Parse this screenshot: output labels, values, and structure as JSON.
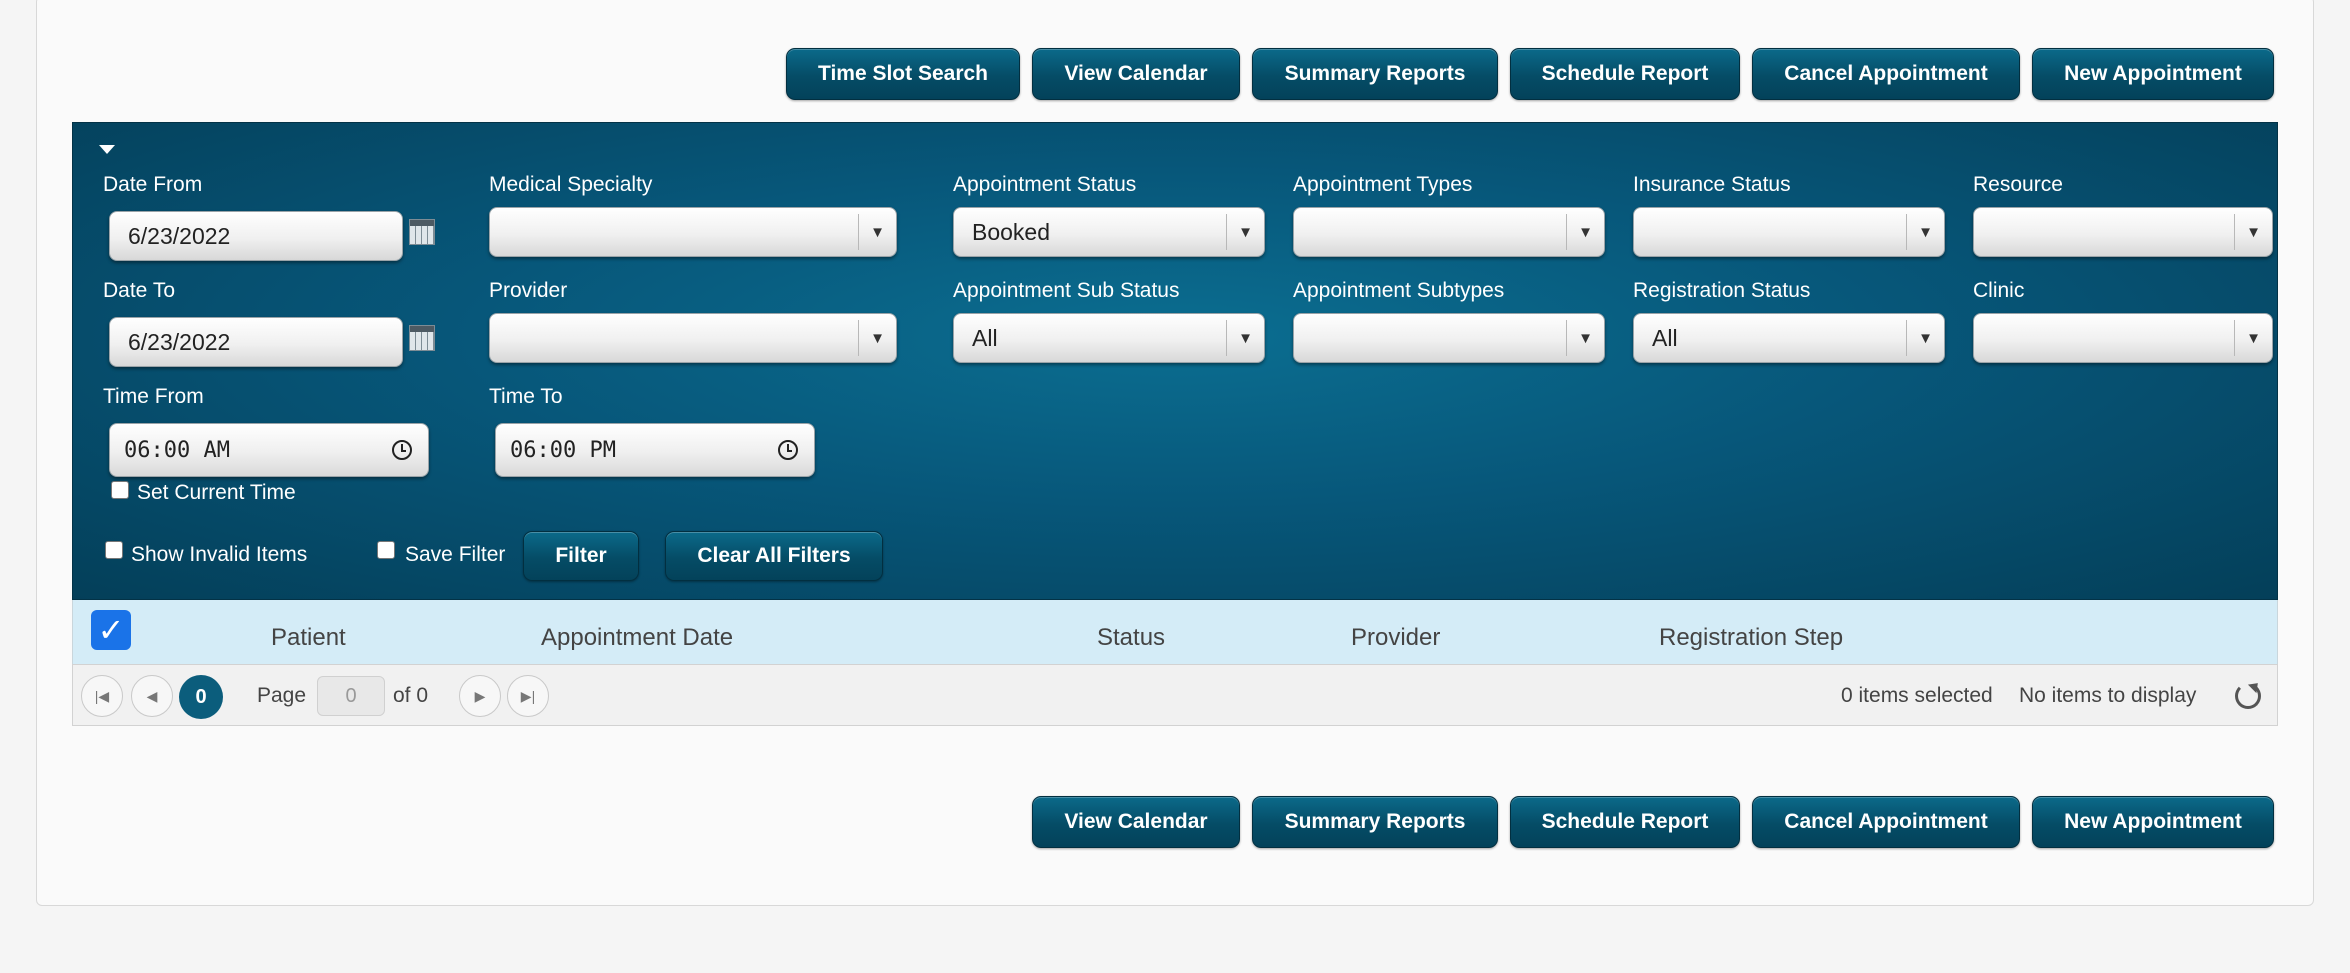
{
  "top_buttons": {
    "time_slot_search": "Time Slot Search",
    "view_calendar": "View Calendar",
    "summary_reports": "Summary Reports",
    "schedule_report": "Schedule Report",
    "cancel_appointment": "Cancel Appointment",
    "new_appointment": "New Appointment"
  },
  "filters": {
    "date_from": {
      "label": "Date From",
      "value": "6/23/2022"
    },
    "date_to": {
      "label": "Date To",
      "value": "6/23/2022"
    },
    "time_from": {
      "label": "Time From",
      "value": "06:00 AM"
    },
    "time_to": {
      "label": "Time To",
      "value": "06:00 PM"
    },
    "set_current_time": "Set Current Time",
    "medical_specialty": {
      "label": "Medical Specialty",
      "value": ""
    },
    "provider": {
      "label": "Provider",
      "value": ""
    },
    "appointment_status": {
      "label": "Appointment Status",
      "value": "Booked"
    },
    "appointment_sub_status": {
      "label": "Appointment Sub Status",
      "value": "All"
    },
    "appointment_types": {
      "label": "Appointment Types",
      "value": ""
    },
    "appointment_subtypes": {
      "label": "Appointment Subtypes",
      "value": ""
    },
    "insurance_status": {
      "label": "Insurance Status",
      "value": ""
    },
    "registration_status": {
      "label": "Registration Status",
      "value": "All"
    },
    "resource": {
      "label": "Resource",
      "value": ""
    },
    "clinic": {
      "label": "Clinic",
      "value": ""
    },
    "show_invalid_items": "Show Invalid Items",
    "save_filter": "Save Filter",
    "filter_button": "Filter",
    "clear_all_filters": "Clear All Filters"
  },
  "grid": {
    "columns": [
      "Patient",
      "Appointment Date",
      "Status",
      "Provider",
      "Registration Step"
    ],
    "header_checkbox_checked": true
  },
  "pager": {
    "current_page": "0",
    "page_label": "Page",
    "page_input": "0",
    "of_label": "of 0",
    "items_selected": "0 items selected",
    "no_items": "No items to display"
  },
  "bottom_buttons": {
    "view_calendar": "View Calendar",
    "summary_reports": "Summary Reports",
    "schedule_report": "Schedule Report",
    "cancel_appointment": "Cancel Appointment",
    "new_appointment": "New Appointment"
  },
  "colors": {
    "button_blue": "#054c66",
    "panel_blue": "#07577a",
    "grid_header_bg": "#d4ecf7",
    "checkbox_blue": "#1a73e8"
  },
  "icons": {
    "date_picker": "calendar-icon",
    "time_picker": "clock-icon",
    "dropdown": "chevron-down-icon",
    "refresh": "refresh-icon"
  }
}
